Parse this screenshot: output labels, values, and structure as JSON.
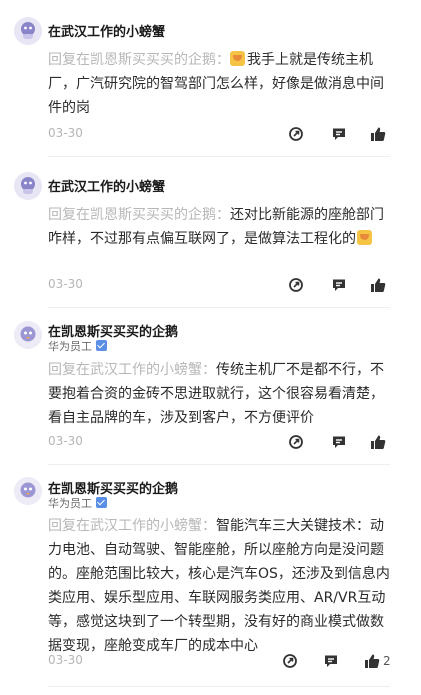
{
  "comments": [
    {
      "author": "在武汉工作的小螃蟹",
      "badge": "",
      "reply_prefix": "回复在凯恩斯买买买的企鹅：",
      "reply_text": "我手上就是传统主机厂，广汽研究院的智驾部门怎么样，好像是做消息中间件的岗",
      "date": "03-30",
      "likes": ""
    },
    {
      "author": "在武汉工作的小螃蟹",
      "badge": "",
      "reply_prefix": "回复在凯恩斯买买买的企鹅：",
      "reply_text": "还对比新能源的座舱部门咋样，不过那有点偏互联网了，是做算法工程化的",
      "date": "03-30",
      "likes": ""
    },
    {
      "author": "在凯恩斯买买买的企鹅",
      "badge": "华为员工",
      "reply_prefix": "回复在武汉工作的小螃蟹：",
      "reply_text": "传统主机厂不是都不行，不要抱着合资的金砖不思进取就行，这个很容易看清楚，看自主品牌的车，涉及到客户，不方便评价",
      "date": "03-30",
      "likes": ""
    },
    {
      "author": "在凯恩斯买买买的企鹅",
      "badge": "华为员工",
      "reply_prefix": "回复在武汉工作的小螃蟹：",
      "reply_text": "智能汽车三大关键技术：动力电池、自动驾驶、智能座舱，所以座舱方向是没问题的。座舱范围比较大，核心是汽车OS，还涉及到信息内类应用、娱乐型应用、车联网服务类应用、AR/VR互动等，感觉这块到了一个转型期，没有好的商业模式做数据变现，座舱变成车厂的成本中心",
      "date": "03-30",
      "likes": "2"
    }
  ],
  "colors": {
    "accent": "#5b8fe6",
    "reply_prefix": "#b7b7b7",
    "date": "#b5b5b5",
    "icon": "#333333"
  },
  "icons": [
    "avatar-icon",
    "share-icon",
    "comment-icon",
    "like-icon",
    "verified-icon",
    "emoji-icon"
  ]
}
